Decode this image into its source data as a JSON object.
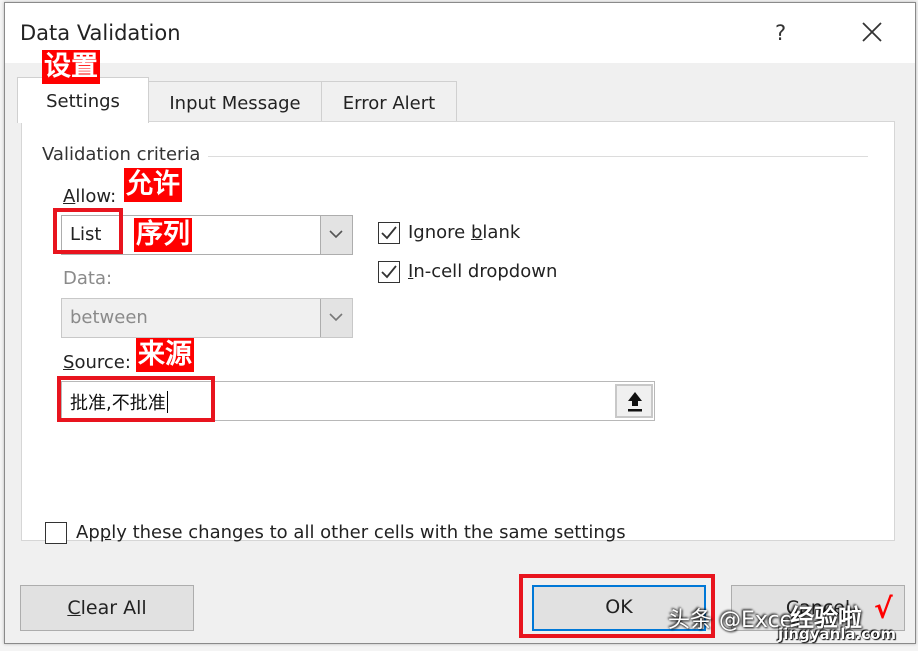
{
  "window": {
    "title": "Data Validation",
    "help_label": "?",
    "close_icon": "close-icon"
  },
  "tabs": [
    {
      "label": "Settings",
      "active": true
    },
    {
      "label": "Input Message",
      "active": false
    },
    {
      "label": "Error Alert",
      "active": false
    }
  ],
  "settings": {
    "group_label": "Validation criteria",
    "allow": {
      "label": "Allow:",
      "value": "List"
    },
    "data": {
      "label": "Data:",
      "value": "between",
      "disabled": true
    },
    "source": {
      "label": "Source:",
      "value": "批准,不批准",
      "collapse_icon": "collapse-dialog-icon"
    },
    "ignore_blank": {
      "label": "Ignore blank",
      "checked": true
    },
    "in_cell_dropdown": {
      "label": "In-cell dropdown",
      "checked": true
    },
    "apply_all": {
      "label": "Apply these changes to all other cells with the same settings",
      "checked": false
    }
  },
  "buttons": {
    "clear_all": "Clear All",
    "ok": "OK",
    "cancel": "Cancel"
  },
  "annotations": {
    "settings": "设置",
    "allow": "允许",
    "list": "序列",
    "source": "来源",
    "highlight_color": "#e8141e"
  },
  "watermark": {
    "text": "头条 @Excel",
    "brand": "经验啦",
    "check": "√",
    "url": "jingyanla.com"
  }
}
